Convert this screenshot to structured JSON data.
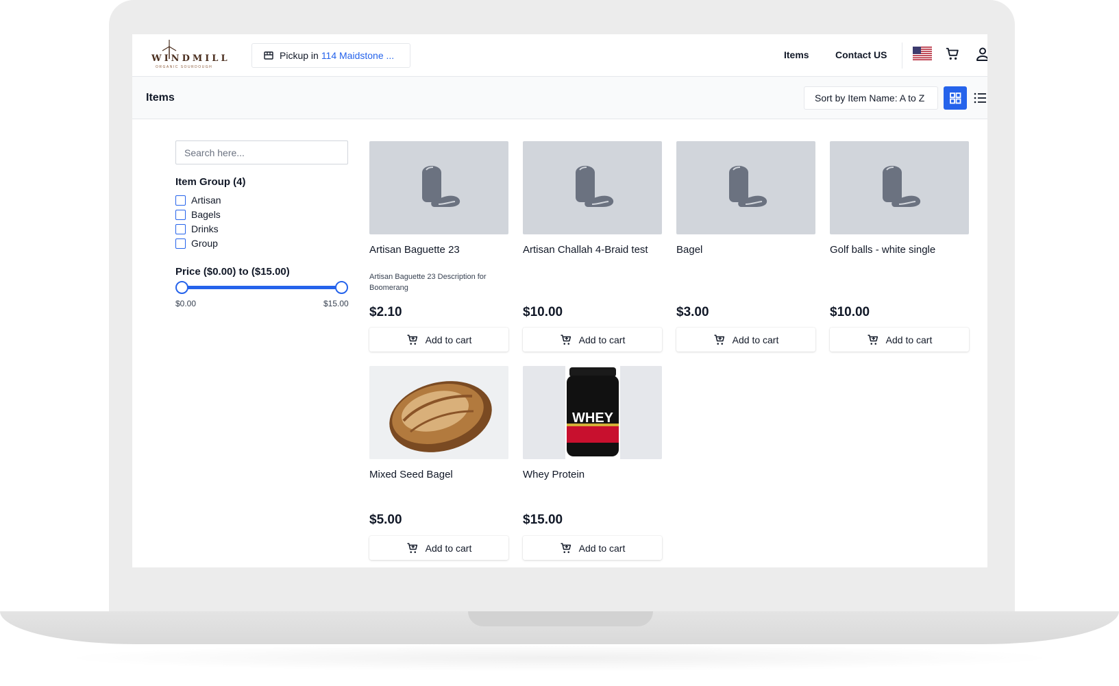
{
  "header": {
    "logo_text": "WINDMILL",
    "logo_subtext": "ORGANIC SOURDOUGH",
    "pickup_prefix": "Pickup in",
    "pickup_location": "114 Maidstone ...",
    "nav": [
      {
        "label": "Items"
      },
      {
        "label": "Contact US"
      }
    ]
  },
  "subheader": {
    "title": "Items",
    "sort_label": "Sort by Item Name: A to Z"
  },
  "sidebar": {
    "search_placeholder": "Search here...",
    "group_title": "Item Group (4)",
    "groups": [
      {
        "label": "Artisan",
        "checked": false
      },
      {
        "label": "Bagels",
        "checked": false
      },
      {
        "label": "Drinks",
        "checked": false
      },
      {
        "label": "Group",
        "checked": false
      }
    ],
    "price_title": "Price ($0.00) to ($15.00)",
    "price_min_label": "$0.00",
    "price_max_label": "$15.00"
  },
  "products": [
    {
      "name": "Artisan Baguette 23",
      "description": "Artisan Baguette 23 Description for Boomerang",
      "price": "$2.10",
      "image": "placeholder-bread-icon",
      "button": "Add to cart"
    },
    {
      "name": "Artisan Challah 4-Braid test",
      "description": "",
      "price": "$10.00",
      "image": "placeholder-bread-icon",
      "button": "Add to cart"
    },
    {
      "name": "Bagel",
      "description": "",
      "price": "$3.00",
      "image": "placeholder-bread-icon",
      "button": "Add to cart"
    },
    {
      "name": "Golf balls - white single",
      "description": "",
      "price": "$10.00",
      "image": "placeholder-bread-icon",
      "button": "Add to cart"
    },
    {
      "name": "Mixed Seed Bagel",
      "description": "",
      "price": "$5.00",
      "image": "sourdough-loaf-photo",
      "button": "Add to cart"
    },
    {
      "name": "Whey Protein",
      "description": "",
      "price": "$15.00",
      "image": "whey-tub-photo",
      "image_text": "WHEY",
      "button": "Add to cart"
    }
  ],
  "colors": {
    "accent": "#2563eb",
    "placeholder_bg": "#d1d5db",
    "placeholder_icon": "#6b7280"
  }
}
